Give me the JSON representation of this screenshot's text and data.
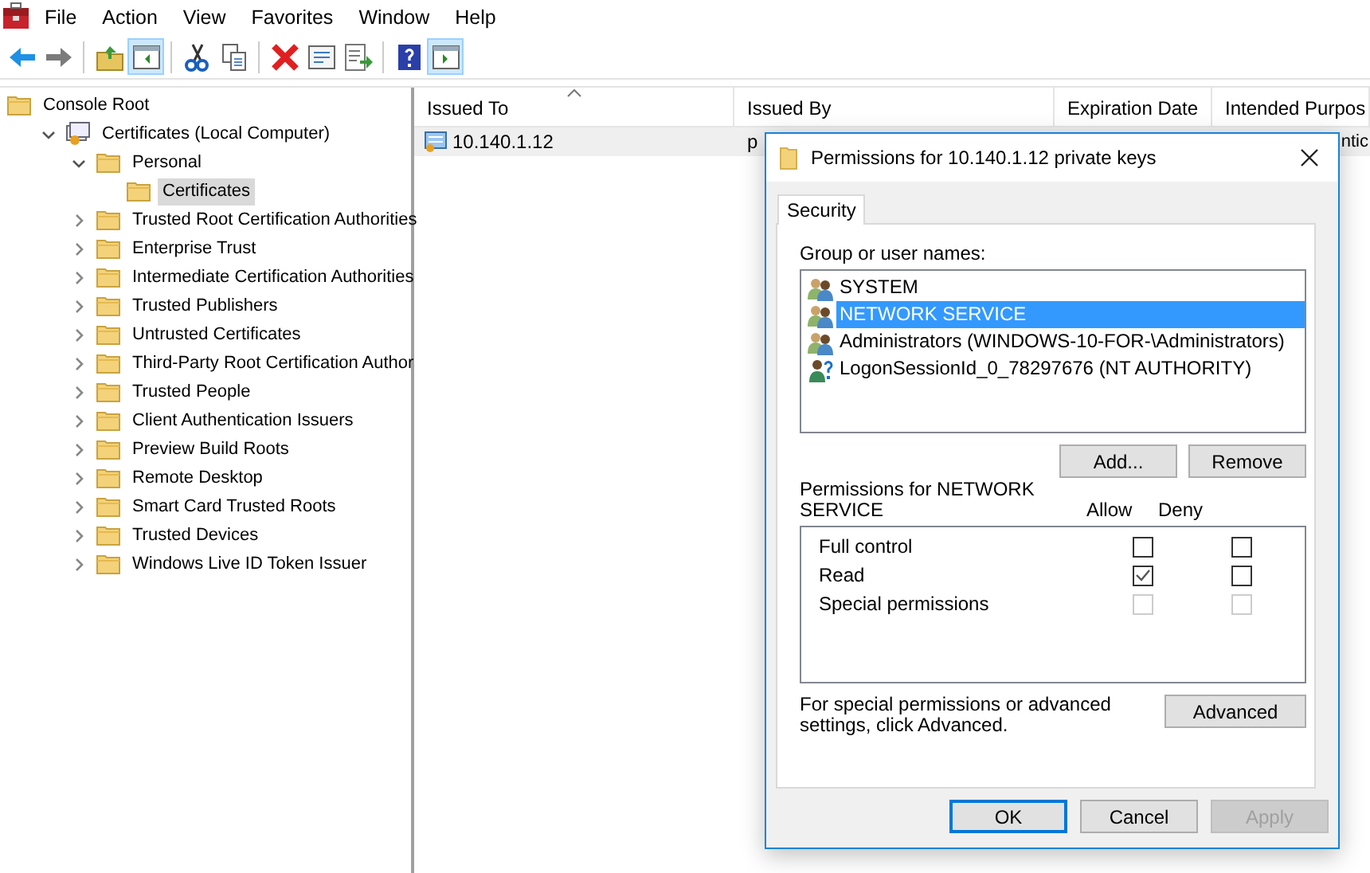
{
  "menu": [
    "File",
    "Action",
    "View",
    "Favorites",
    "Window",
    "Help"
  ],
  "toolbar": [
    {
      "kind": "back",
      "pressed": false
    },
    {
      "kind": "forward",
      "pressed": false
    },
    {
      "kind": "sep"
    },
    {
      "kind": "up",
      "pressed": false
    },
    {
      "kind": "tree",
      "pressed": true
    },
    {
      "kind": "sep"
    },
    {
      "kind": "cut",
      "pressed": false
    },
    {
      "kind": "copy",
      "pressed": false
    },
    {
      "kind": "sep"
    },
    {
      "kind": "delete",
      "pressed": false
    },
    {
      "kind": "properties",
      "pressed": false
    },
    {
      "kind": "export",
      "pressed": false
    },
    {
      "kind": "sep"
    },
    {
      "kind": "help",
      "pressed": false
    },
    {
      "kind": "actions",
      "pressed": true
    }
  ],
  "tree": [
    {
      "label": "Console Root",
      "kind": "root",
      "selected": false,
      "children": [
        {
          "label": "Certificates (Local Computer)",
          "kind": "store",
          "expanded": true,
          "selected": false,
          "children": [
            {
              "label": "Personal",
              "kind": "folder",
              "expanded": true,
              "selected": false,
              "children": [
                {
                  "label": "Certificates",
                  "kind": "folder",
                  "selected": true
                }
              ]
            },
            {
              "label": "Trusted Root Certification Authorities",
              "kind": "folder",
              "expanded": false,
              "selected": false
            },
            {
              "label": "Enterprise Trust",
              "kind": "folder",
              "expanded": false,
              "selected": false
            },
            {
              "label": "Intermediate Certification Authorities",
              "kind": "folder",
              "expanded": false,
              "selected": false
            },
            {
              "label": "Trusted Publishers",
              "kind": "folder",
              "expanded": false,
              "selected": false
            },
            {
              "label": "Untrusted Certificates",
              "kind": "folder",
              "expanded": false,
              "selected": false
            },
            {
              "label": "Third-Party Root Certification Author",
              "kind": "folder",
              "expanded": false,
              "selected": false
            },
            {
              "label": "Trusted People",
              "kind": "folder",
              "expanded": false,
              "selected": false
            },
            {
              "label": "Client Authentication Issuers",
              "kind": "folder",
              "expanded": false,
              "selected": false
            },
            {
              "label": "Preview Build Roots",
              "kind": "folder",
              "expanded": false,
              "selected": false
            },
            {
              "label": "Remote Desktop",
              "kind": "folder",
              "expanded": false,
              "selected": false
            },
            {
              "label": "Smart Card Trusted Roots",
              "kind": "folder",
              "expanded": false,
              "selected": false
            },
            {
              "label": "Trusted Devices",
              "kind": "folder",
              "expanded": false,
              "selected": false
            },
            {
              "label": "Windows Live ID Token Issuer",
              "kind": "folder",
              "expanded": false,
              "selected": false
            }
          ]
        }
      ]
    }
  ],
  "table": {
    "columns": [
      {
        "label": "Issued To",
        "sorted": true
      },
      {
        "label": "Issued By",
        "sorted": false
      },
      {
        "label": "Expiration Date",
        "sorted": false
      },
      {
        "label": "Intended Purpos",
        "sorted": false
      }
    ],
    "rows": [
      {
        "cells": [
          "10.140.1.12",
          "p",
          "",
          "ntic"
        ],
        "selected": true
      }
    ]
  },
  "dialog": {
    "title": "Permissions for 10.140.1.12 private keys",
    "tabs": [
      {
        "label": "Security",
        "selected": true
      }
    ],
    "users_label": "Group or user names:",
    "users": [
      {
        "name": "SYSTEM",
        "kind": "group",
        "selected": false
      },
      {
        "name": "NETWORK SERVICE",
        "kind": "group",
        "selected": true
      },
      {
        "name": "Administrators (WINDOWS-10-FOR-\\Administrators)",
        "kind": "group",
        "selected": false
      },
      {
        "name": "LogonSessionId_0_78297676 (NT AUTHORITY)",
        "kind": "unknown",
        "selected": false
      }
    ],
    "user_buttons": [
      {
        "label": "Add...",
        "disabled": false
      },
      {
        "label": "Remove",
        "disabled": false
      }
    ],
    "permissions_label": "Permissions for NETWORK SERVICE",
    "allow_label": "Allow",
    "deny_label": "Deny",
    "permissions": [
      {
        "name": "Full control",
        "allow": {
          "checked": false,
          "disabled": false
        },
        "deny": {
          "checked": false,
          "disabled": false
        }
      },
      {
        "name": "Read",
        "allow": {
          "checked": true,
          "disabled": false
        },
        "deny": {
          "checked": false,
          "disabled": false
        }
      },
      {
        "name": "Special permissions",
        "allow": {
          "checked": false,
          "disabled": true
        },
        "deny": {
          "checked": false,
          "disabled": true
        }
      }
    ],
    "advanced_text": "For special permissions or advanced settings, click Advanced.",
    "advanced_button": {
      "label": "Advanced",
      "disabled": false
    },
    "buttons": [
      {
        "label": "OK",
        "default": true,
        "disabled": false
      },
      {
        "label": "Cancel",
        "default": false,
        "disabled": false
      },
      {
        "label": "Apply",
        "default": false,
        "disabled": true
      }
    ]
  }
}
